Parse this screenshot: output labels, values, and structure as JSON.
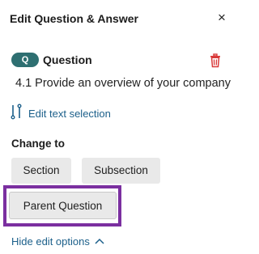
{
  "panel": {
    "title": "Edit Question & Answer",
    "close_symbol": "×"
  },
  "question": {
    "badge": "Q",
    "label": "Question",
    "text": "4.1 Provide an overview of your company",
    "accent_color": "#2e6f71"
  },
  "edit_selection": {
    "label": "Edit text selection",
    "icon": "text-selection-icon"
  },
  "change_to": {
    "heading": "Change to",
    "options": [
      "Section",
      "Subsection",
      "Parent Question"
    ],
    "highlighted_option": "Parent Question",
    "highlight_color": "#7b2fa0"
  },
  "footer": {
    "hide_label": "Hide edit options",
    "icon": "chevron-up-icon"
  },
  "colors": {
    "link": "#1b5f8a",
    "delete": "#d93a3a"
  }
}
